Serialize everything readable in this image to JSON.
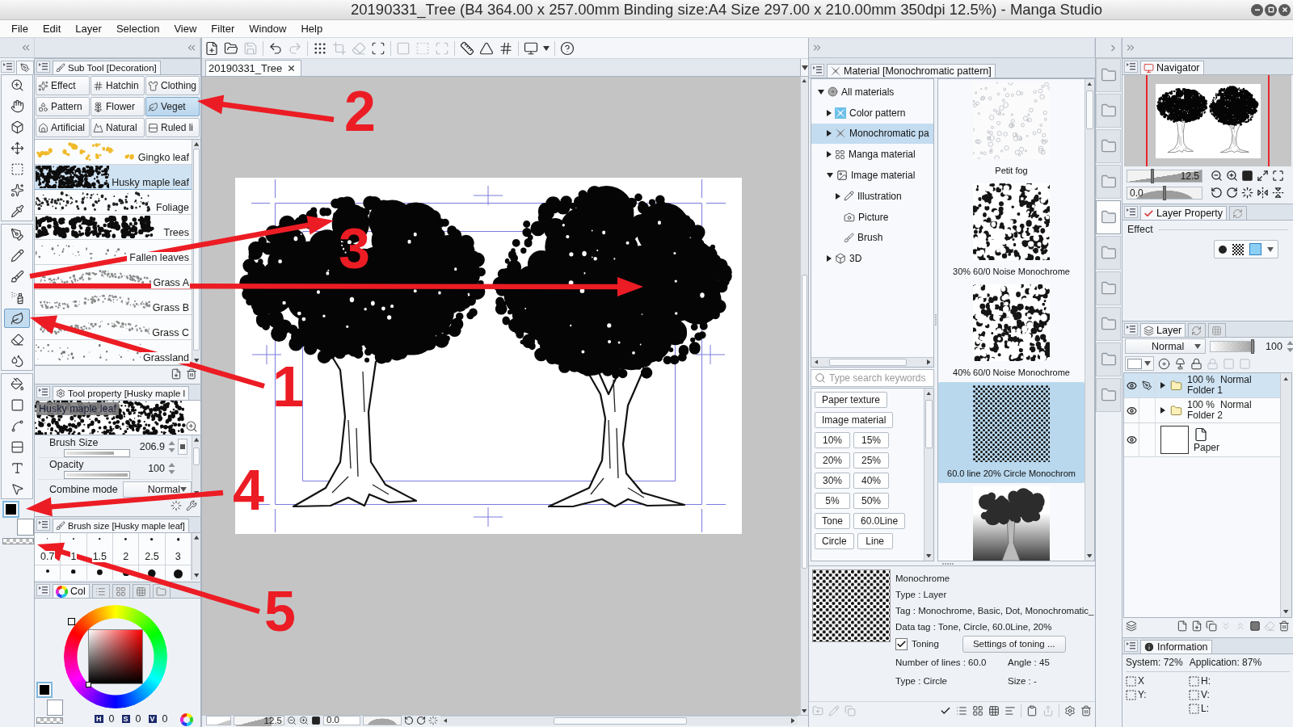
{
  "window": {
    "title": "20190331_Tree (B4 364.00 x 257.00mm Binding size:A4 Size 297.00 x 210.00mm 350dpi 12.5%) - Manga Studio"
  },
  "menu": [
    "File",
    "Edit",
    "Layer",
    "Selection",
    "View",
    "Filter",
    "Window",
    "Help"
  ],
  "toolbar": [
    {
      "disabled": false
    },
    {
      "disabled": false
    },
    {
      "disabled": true
    },
    {
      "disabled": false
    },
    {
      "disabled": true
    },
    {
      "disabled": false
    },
    {
      "disabled": true
    },
    {
      "disabled": true
    },
    {
      "disabled": false
    },
    {
      "disabled": true
    },
    {
      "disabled": true
    },
    {
      "disabled": true
    },
    {
      "disabled": false
    },
    {
      "disabled": false
    },
    {
      "disabled": false
    },
    {
      "disabled": false
    },
    {
      "disabled": false
    }
  ],
  "tool_groups": [
    [
      {
        "selected": false
      },
      {
        "selected": false
      },
      {
        "selected": false
      },
      {
        "selected": false
      },
      {
        "selected": false
      },
      {
        "selected": false
      },
      {
        "selected": false
      }
    ],
    [
      {
        "selected": false
      },
      {
        "selected": false
      },
      {
        "selected": false
      },
      {
        "selected": false
      },
      {
        "selected": true
      },
      {
        "selected": false
      },
      {
        "selected": false
      }
    ],
    [
      {
        "selected": false
      },
      {
        "selected": false
      },
      {
        "selected": false
      },
      {
        "selected": false
      },
      {
        "selected": false
      },
      {
        "selected": false
      }
    ]
  ],
  "sub_tool": {
    "title": "Sub Tool [Decoration]",
    "groups": [
      {
        "label": "Effect",
        "selected": false
      },
      {
        "label": "Hatchin",
        "selected": false
      },
      {
        "label": "Clothing",
        "selected": false
      },
      {
        "label": "Pattern",
        "selected": false
      },
      {
        "label": "Flower",
        "selected": false
      },
      {
        "label": "Veget",
        "selected": true
      },
      {
        "label": "Artificial",
        "selected": false
      },
      {
        "label": "Natural",
        "selected": false
      },
      {
        "label": "Ruled li",
        "selected": false
      }
    ],
    "brushes": [
      {
        "name": "Gingko leaf",
        "kind": "dots",
        "selected": false
      },
      {
        "name": "Husky maple leaf",
        "kind": "foliage",
        "selected": true
      },
      {
        "name": "Foliage",
        "kind": "sparse",
        "selected": false
      },
      {
        "name": "Trees",
        "kind": "trees",
        "selected": false
      },
      {
        "name": "Fallen leaves",
        "kind": "scatter",
        "selected": false
      },
      {
        "name": "Grass A",
        "kind": "grass",
        "selected": false
      },
      {
        "name": "Grass B",
        "kind": "grass",
        "selected": false
      },
      {
        "name": "Grass C",
        "kind": "grass",
        "selected": false
      },
      {
        "name": "Grassland",
        "kind": "scatter",
        "selected": false
      }
    ]
  },
  "tool_property": {
    "title": "Tool property [Husky maple l",
    "preview_label": "Husky maple leaf",
    "settings": [
      {
        "label": "Brush Size",
        "value": "206.9",
        "level": 0.78
      },
      {
        "label": "Opacity",
        "value": "100",
        "level": 1
      }
    ],
    "combine_mode": {
      "label": "Combine mode",
      "value": "Normal"
    }
  },
  "brush_size": {
    "title": "Brush size [Husky maple leaf]",
    "sizes": [
      {
        "label": "0.7",
        "selected": false
      },
      {
        "label": "1",
        "selected": false
      },
      {
        "label": "1.5",
        "selected": false
      },
      {
        "label": "2",
        "selected": false
      },
      {
        "label": "2.5",
        "selected": false
      },
      {
        "label": "3",
        "selected": false
      }
    ]
  },
  "color": {
    "tabs": [
      {
        "label": "Col",
        "selected": true
      },
      {
        "selected": false
      },
      {
        "selected": false
      },
      {
        "selected": false
      },
      {
        "selected": false
      }
    ],
    "hsv": [
      {
        "label": "H",
        "value": "0"
      },
      {
        "label": "S",
        "value": "0"
      },
      {
        "label": "V",
        "value": "0"
      }
    ]
  },
  "canvas": {
    "tab": "20190331_Tree",
    "zoom": {
      "value": "12.5",
      "level": 0.75
    },
    "angle": "0.0"
  },
  "material": {
    "title": "Material [Monochromatic pattern]",
    "tree": [
      {
        "label": "All materials",
        "expanded": true,
        "selected": false,
        "children": [
          {
            "label": "Color pattern",
            "expanded": false,
            "selected": false
          },
          {
            "label": "Monochromatic pa",
            "expanded": false,
            "selected": true
          },
          {
            "label": "Manga material",
            "expanded": false,
            "selected": false
          },
          {
            "label": "Image material",
            "expanded": true,
            "selected": false,
            "children": [
              {
                "label": "Illustration",
                "expanded": false,
                "selected": false
              },
              {
                "label": "Picture",
                "selected": false
              },
              {
                "label": "Brush",
                "selected": false
              }
            ]
          },
          {
            "label": "3D",
            "expanded": false,
            "selected": false
          }
        ]
      }
    ],
    "items": [
      {
        "label": "Petit fog",
        "kind": "fog",
        "selected": false
      },
      {
        "label": "30% 60/0 Noise Monochrome",
        "kind": "noise",
        "selected": false
      },
      {
        "label": "40% 60/0 Noise Monochrome",
        "kind": "noise",
        "selected": false
      },
      {
        "label": "60.0 line 20% Circle Monochrom",
        "kind": "dots",
        "selected": true
      },
      {
        "kind": "tree",
        "selected": false
      }
    ],
    "search": {
      "placeholder": "Type search keywords"
    },
    "tags": [
      "Paper texture",
      "Image material",
      "10%",
      "15%",
      "20%",
      "25%",
      "30%",
      "40%",
      "5%",
      "50%",
      "Tone",
      "60.0Line",
      "Circle",
      "Line"
    ],
    "details": {
      "name": "Monochrome",
      "type": "Type : Layer",
      "tag": "Tag : Monochrome, Basic, Dot, Monochromatic_",
      "data_tag": "Data tag : Tone, Circle, 60.0Line, 20%",
      "toning": {
        "label": "Toning",
        "checked": true
      },
      "settings_button": "Settings of toning ...",
      "pairs": [
        [
          "Number of lines : 60.0",
          "Angle : 45"
        ],
        [
          "Type : Circle",
          "Size : -"
        ]
      ]
    }
  },
  "material_shortcuts": [
    {
      "selected": false
    },
    {
      "selected": false
    },
    {
      "selected": false
    },
    {
      "selected": false
    },
    {
      "selected": true
    },
    {
      "selected": false
    },
    {
      "selected": false
    },
    {
      "selected": false
    },
    {
      "selected": false
    },
    {
      "selected": false
    }
  ],
  "navigator": {
    "title": "Navigator",
    "sliders": [
      {
        "value": "12.5",
        "level": 0.34
      },
      {
        "value": "0.0",
        "level": 0.5
      }
    ]
  },
  "layer_property": {
    "tabs": [
      {
        "label": "Layer Property",
        "selected": true
      },
      {
        "selected": false
      }
    ],
    "effect": "Effect"
  },
  "layer": {
    "tabs": [
      {
        "label": "Layer",
        "selected": true
      },
      {
        "selected": false
      },
      {
        "selected": false
      }
    ],
    "blend_mode": "Normal",
    "opacity": {
      "value": "100",
      "level": 1
    },
    "layers": [
      {
        "kind": "folder",
        "opacity": "100 %",
        "mode": "Normal",
        "name": "Folder 1",
        "expanded": false,
        "visible": true,
        "editing": true,
        "selected": true
      },
      {
        "kind": "folder",
        "opacity": "100 %",
        "mode": "Normal",
        "name": "Folder 2",
        "expanded": false,
        "visible": true,
        "editing": false,
        "selected": false
      },
      {
        "kind": "paper",
        "name": "Paper",
        "visible": true,
        "editing": false,
        "selected": false
      }
    ]
  },
  "information": {
    "title": "Information",
    "system": "System: 72%",
    "application": "Application: 87%",
    "columns": [
      [
        "X",
        "Y:"
      ],
      [
        "H:",
        "V:",
        "L:"
      ]
    ]
  },
  "annotations": [
    {
      "label": "1"
    },
    {
      "label": "2"
    },
    {
      "label": "3"
    },
    {
      "label": "4"
    },
    {
      "label": "5"
    }
  ]
}
